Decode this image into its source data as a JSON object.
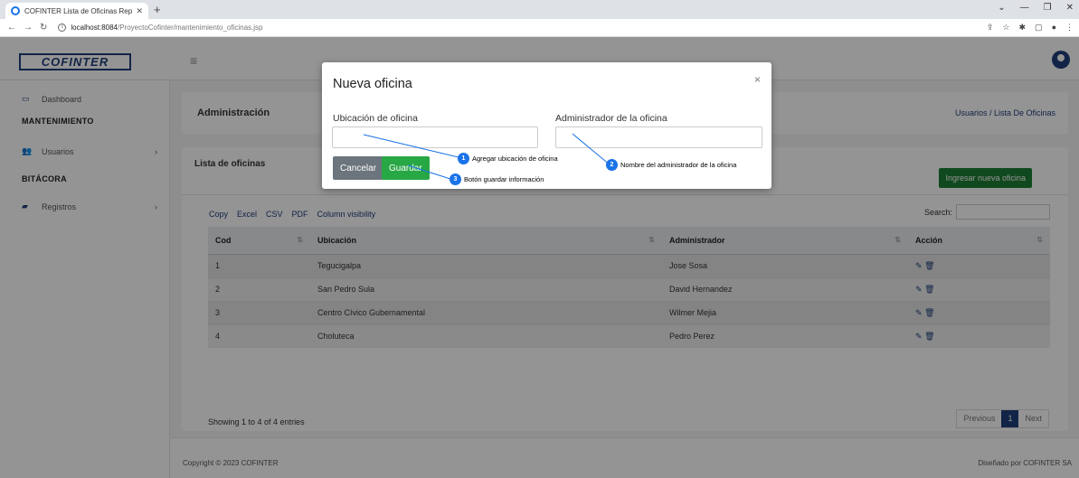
{
  "browser": {
    "tab_title": "COFINTER Lista de Oficinas Repo",
    "url_host": "localhost:8084",
    "url_path": "/ProyectoCofinter/mantenimiento_oficinas.jsp"
  },
  "app": {
    "logo": "COFINTER"
  },
  "sidebar": {
    "dashboard": "Dashboard",
    "section_mantenimiento": "MANTENIMIENTO",
    "usuarios": "Usuarios",
    "section_bitacora": "BITÁCORA",
    "registros": "Registros"
  },
  "header": {
    "title": "Administración",
    "breadcrumb": "Usuarios / Lista De Oficinas"
  },
  "card": {
    "title": "Lista de oficinas",
    "add_button": "Ingresar nueva oficina",
    "export_buttons": [
      "Copy",
      "Excel",
      "CSV",
      "PDF",
      "Column visibility"
    ],
    "search_label": "Search:",
    "columns": [
      "Cod",
      "Ubicación",
      "Administrador",
      "Acción"
    ],
    "rows": [
      {
        "cod": "1",
        "ubicacion": "Tegucigalpa",
        "admin": "Jose Sosa"
      },
      {
        "cod": "2",
        "ubicacion": "San Pedro Sula",
        "admin": "David Hernandez"
      },
      {
        "cod": "3",
        "ubicacion": "Centro Cívico Gubernamental",
        "admin": "Wilmer Mejia"
      },
      {
        "cod": "4",
        "ubicacion": "Choluteca",
        "admin": "Pedro Perez"
      }
    ],
    "info": "Showing 1 to 4 of 4 entries",
    "pager": {
      "previous": "Previous",
      "current": "1",
      "next": "Next"
    }
  },
  "footer": {
    "left": "Copyright © 2023 COFINTER",
    "right": "Diseñado por COFINTER SA"
  },
  "modal": {
    "title": "Nueva oficina",
    "field1_label": "Ubicación de oficina",
    "field2_label": "Administrador de la oficina",
    "cancel": "Cancelar",
    "save": "Guardar"
  },
  "callouts": [
    {
      "num": "1",
      "text": "Agregar ubicación de oficina"
    },
    {
      "num": "2",
      "text": "Nombre del administrador de la oficina"
    },
    {
      "num": "3",
      "text": "Botón guardar información"
    }
  ]
}
